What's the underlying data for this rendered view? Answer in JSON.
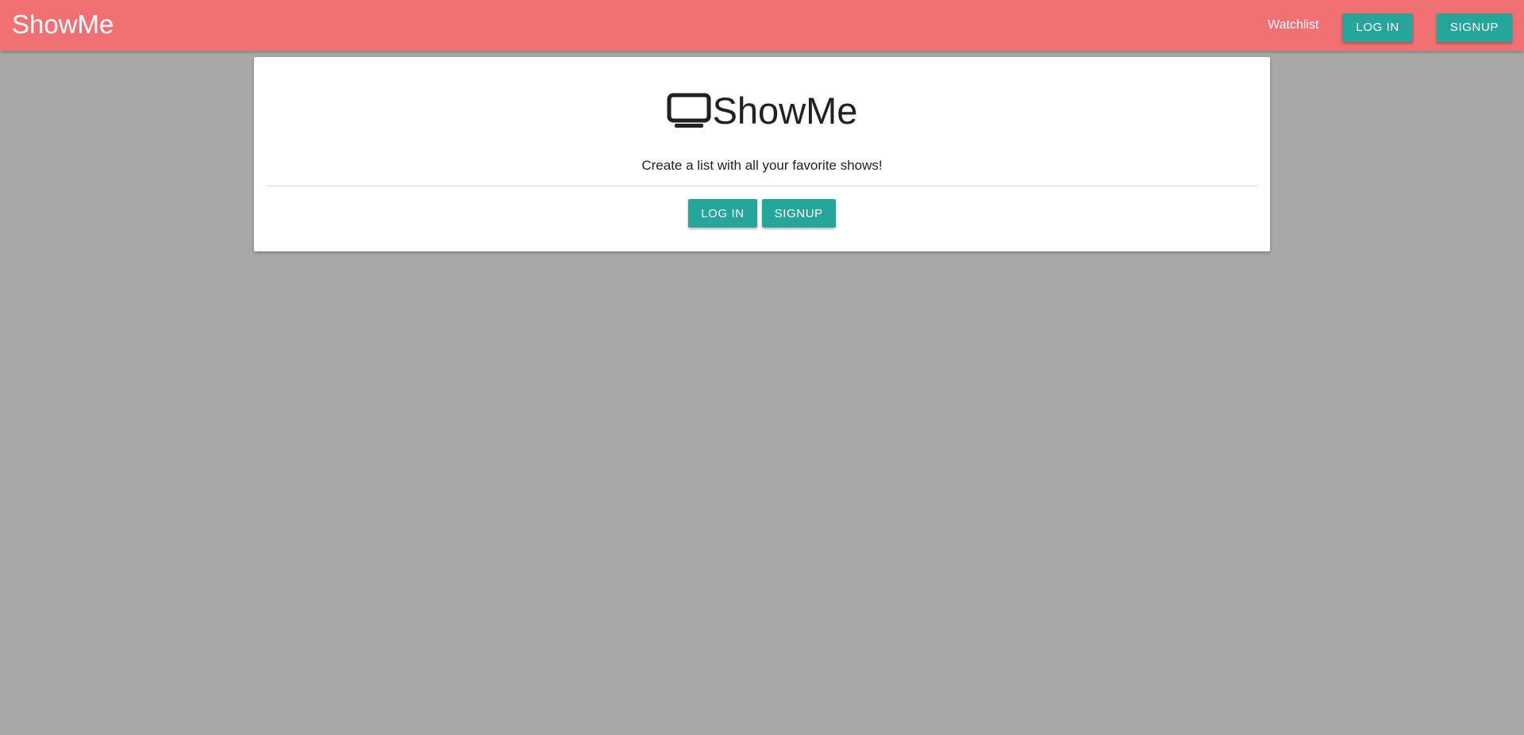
{
  "navbar": {
    "brand": "ShowMe",
    "links": {
      "watchlist": "Watchlist"
    },
    "login_label": "LOG IN",
    "signup_label": "SIGNUP",
    "background": "#f07074"
  },
  "hero": {
    "icon": "tv-icon",
    "title": "ShowMe",
    "tagline": "Create a list with all your favorite shows!",
    "login_label": "LOG IN",
    "signup_label": "SIGNUP"
  },
  "colors": {
    "accent": "#26a69a",
    "page_background": "#a9a9a9",
    "card_background": "#ffffff"
  }
}
